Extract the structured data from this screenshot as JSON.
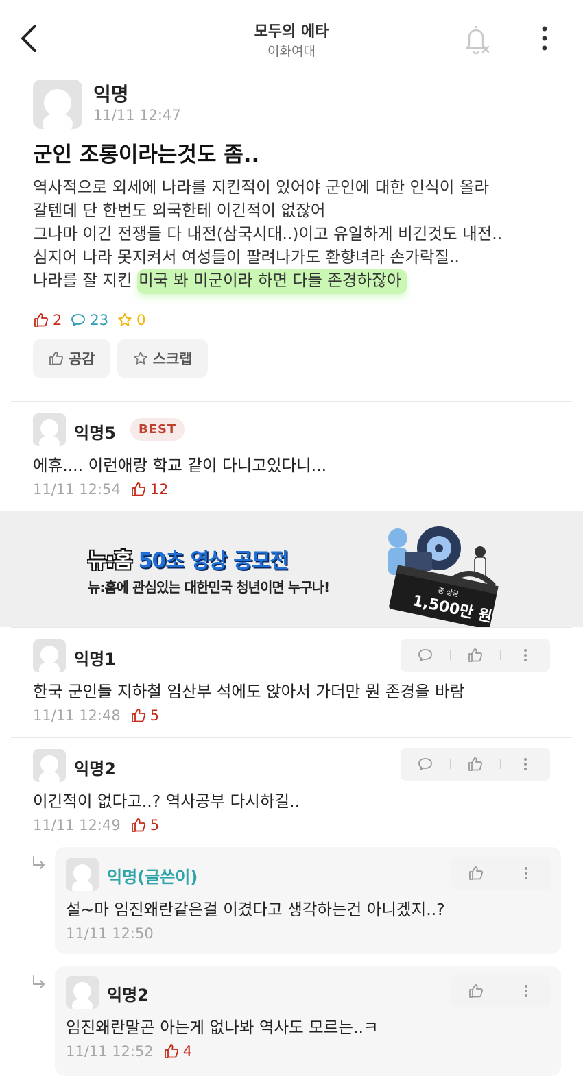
{
  "header": {
    "title": "모두의 에타",
    "subtitle": "이화여대"
  },
  "post": {
    "author": "익명",
    "time": "11/11 12:47",
    "title": "군인 조롱이라는것도 좀..",
    "body_lines": [
      "역사적으로 외세에 나라를 지킨적이 있어야 군인에 대한 인식이 올라",
      "갈텐데 단 한번도 외국한테 이긴적이 없잖어",
      "그나마 이긴 전쟁들 다 내전(삼국시대..)이고 유일하게 비긴것도 내전..",
      "심지어 나라 못지켜서 여성들이 팔려나가도 환향녀라 손가락질..",
      "나라를 잘 지킨 "
    ],
    "body_highlight": "미국 봐 미군이라 하면 다들 존경하잖아",
    "likes": "2",
    "comments": "23",
    "scraps": "0",
    "like_button": "공감",
    "scrap_button": "스크랩"
  },
  "banner": {
    "title_prefix": "뉴:홈",
    "title_rest": "50초 영상 공모전",
    "subtitle": "뉴:홈에 관심있는 대한민국 청년이면 누구나!",
    "prize_small": "총 상금",
    "prize": "1,500만 원"
  },
  "comments": [
    {
      "author": "익명5",
      "badge": "BEST",
      "body": "에휴.... 이런애랑 학교 같이 다니고있다니...",
      "time": "11/11 12:54",
      "likes": "12"
    },
    {
      "author": "익명1",
      "body": "한국 군인들 지하철 임산부 석에도 앉아서 가더만 뭔 존경을 바람",
      "time": "11/11 12:48",
      "likes": "5"
    },
    {
      "author": "익명2",
      "body": "이긴적이 없다고..? 역사공부 다시하길..",
      "time": "11/11 12:49",
      "likes": "5",
      "replies": [
        {
          "author": "익명(글쓴이)",
          "body": "설~마 임진왜란같은걸 이겼다고 생각하는건 아니겠지..?",
          "time": "11/11 12:50"
        },
        {
          "author": "익명2",
          "body": "임진왜란말곤 아는게 없나봐 역사도 모르는..ㅋ",
          "time": "11/11 12:52",
          "likes": "4"
        }
      ]
    }
  ],
  "colors": {
    "like_red": "#c62917",
    "comment_teal": "#2b9bb3",
    "scrap_yellow": "#f0b400",
    "op_author_teal": "#2ea3a8",
    "highlight_green": "#a0f078"
  },
  "icons": [
    "back-arrow-icon",
    "bell-off-icon",
    "more-vertical-icon",
    "thumbs-up-icon",
    "comment-bubble-icon",
    "star-icon",
    "reply-arrow-icon",
    "avatar-placeholder-icon"
  ]
}
